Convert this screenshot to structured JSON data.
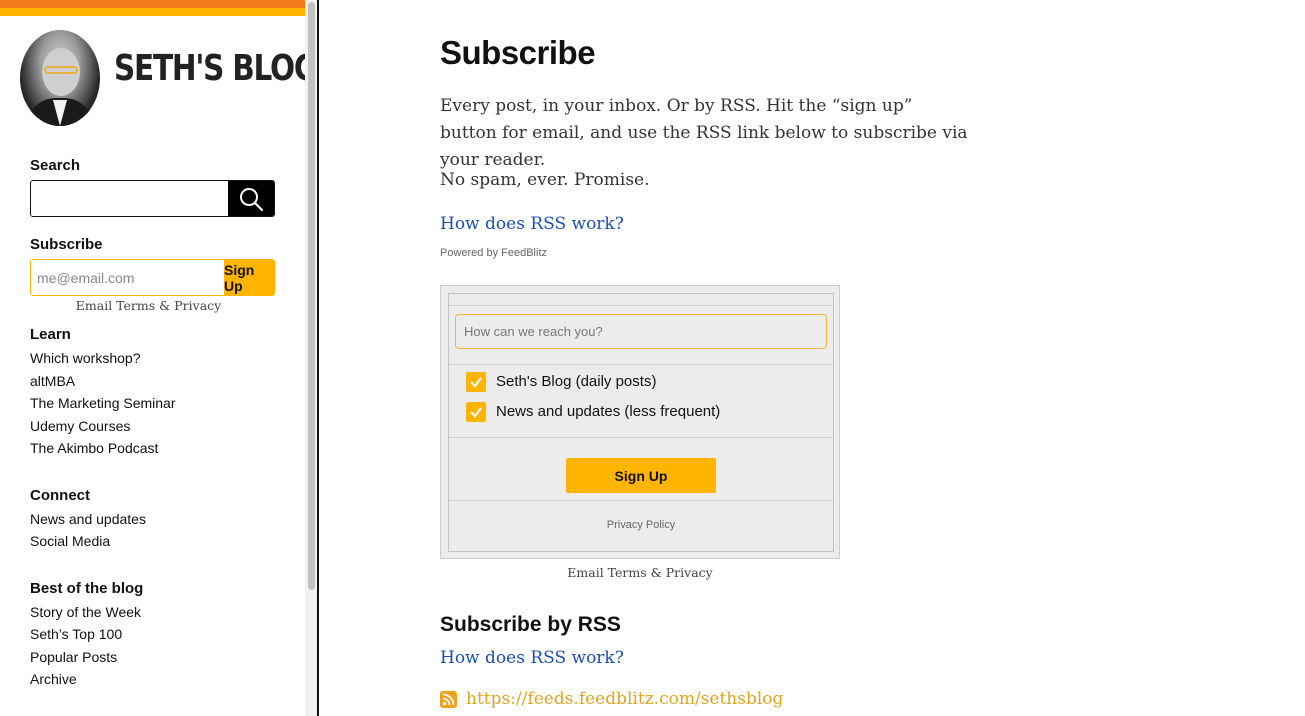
{
  "sidebar": {
    "blog_title": "SETH'S BLOG",
    "search": {
      "label": "Search",
      "value": ""
    },
    "subscribe": {
      "label": "Subscribe",
      "placeholder": "me@email.com",
      "button": "Sign Up",
      "terms": "Email Terms & Privacy"
    },
    "learn": {
      "heading": "Learn",
      "items": [
        "Which workshop?",
        "altMBA",
        "The Marketing Seminar",
        "Udemy Courses",
        "The Akimbo Podcast"
      ]
    },
    "connect": {
      "heading": "Connect",
      "items": [
        "News and updates",
        "Social Media"
      ]
    },
    "best": {
      "heading": "Best of the blog",
      "items": [
        "Story of the Week",
        "Seth’s Top 100",
        "Popular Posts",
        "Archive"
      ]
    }
  },
  "main": {
    "title": "Subscribe",
    "paragraph1": "Every post, in your inbox. Or by RSS. Hit the “sign up” button for email, and use the RSS link below to subscribe via your reader.",
    "paragraph2": "No spam, ever. Promise.",
    "rss_link": "How does RSS work?",
    "powered_by": "Powered by FeedBlitz",
    "form": {
      "placeholder": "How can we reach you?",
      "options": [
        {
          "label": "Seth's Blog (daily posts)",
          "checked": true
        },
        {
          "label": "News and updates (less frequent)",
          "checked": true
        }
      ],
      "button": "Sign Up",
      "privacy": "Privacy Policy"
    },
    "terms": "Email Terms & Privacy",
    "rss_section": {
      "heading": "Subscribe by RSS",
      "link": "How does RSS work?",
      "feed_url": "https://feeds.feedblitz.com/sethsblog"
    }
  },
  "colors": {
    "accent_orange": "#f47c1a",
    "accent_yellow": "#ffb400",
    "link_blue": "#1a4fb5"
  }
}
